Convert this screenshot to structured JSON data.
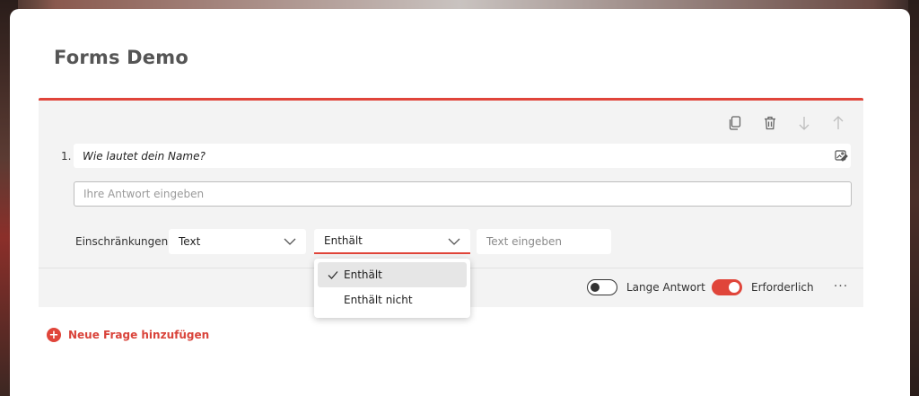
{
  "page": {
    "title": "Forms Demo"
  },
  "question": {
    "number": "1.",
    "title": "Wie lautet dein Name?",
    "answer_placeholder": "Ihre Antwort eingeben"
  },
  "toolbar": {
    "icons": [
      "copy-icon",
      "trash-icon",
      "arrow-down-icon",
      "arrow-up-icon"
    ]
  },
  "constraints": {
    "label": "Einschränkungen",
    "type_value": "Text",
    "condition_value": "Enthält",
    "text_placeholder": "Text eingeben",
    "condition_options": [
      "Enthält",
      "Enthält nicht"
    ],
    "selected_option_index": 0
  },
  "footer": {
    "long_answer_label": "Lange Antwort",
    "long_answer_on": false,
    "required_label": "Erforderlich",
    "required_on": true,
    "more_label": "···"
  },
  "add_question": {
    "label": "Neue Frage hinzufügen",
    "icon_label": "+"
  },
  "colors": {
    "accent": "#e0453a",
    "panel": "#f3f3f3"
  }
}
